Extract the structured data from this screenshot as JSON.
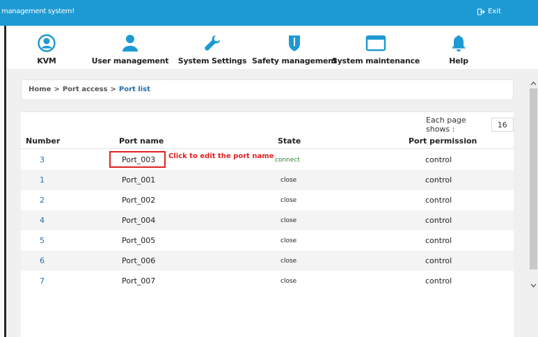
{
  "header": {
    "title": "management system!",
    "exit_label": "Exit"
  },
  "nav": [
    {
      "label": "KVM",
      "icon": "user-circle-icon"
    },
    {
      "label": "User management",
      "icon": "user-icon"
    },
    {
      "label": "System Settings",
      "icon": "wrench-icon"
    },
    {
      "label": "Safety management",
      "icon": "shield-icon"
    },
    {
      "label": "System maintenance",
      "icon": "window-icon"
    },
    {
      "label": "Help",
      "icon": "bell-icon"
    }
  ],
  "breadcrumb": {
    "home": "Home",
    "separator": ">",
    "section": "Port access",
    "current": "Port list"
  },
  "pager": {
    "label": "Each page shows :",
    "value": "16"
  },
  "table": {
    "headers": [
      "Number",
      "Port name",
      "State",
      "Port permission"
    ],
    "rows": [
      {
        "number": "3",
        "name": "Port_003",
        "state": "connect",
        "permission": "control"
      },
      {
        "number": "1",
        "name": "Port_001",
        "state": "close",
        "permission": "control"
      },
      {
        "number": "2",
        "name": "Port_002",
        "state": "close",
        "permission": "control"
      },
      {
        "number": "4",
        "name": "Port_004",
        "state": "close",
        "permission": "control"
      },
      {
        "number": "5",
        "name": "Port_005",
        "state": "close",
        "permission": "control"
      },
      {
        "number": "6",
        "name": "Port_006",
        "state": "close",
        "permission": "control"
      },
      {
        "number": "7",
        "name": "Port_007",
        "state": "close",
        "permission": "control"
      }
    ]
  },
  "annotation": {
    "text": "Click to edit the port name"
  },
  "colors": {
    "topbar": "#1e9ad3",
    "icon": "#1e9ad3",
    "link": "#1e6fb5",
    "connect": "#2a8a2a",
    "callout": "#e02020"
  }
}
